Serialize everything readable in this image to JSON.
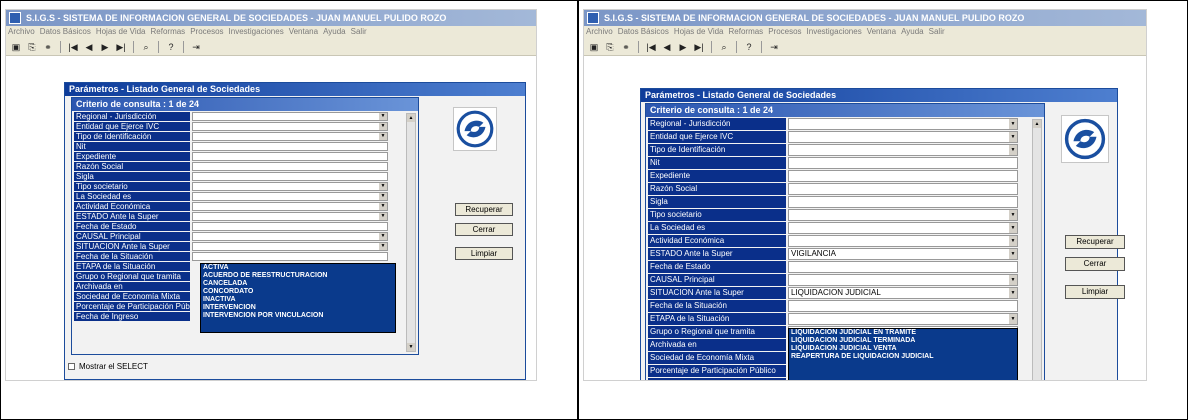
{
  "app": {
    "title": "S.I.G.S   - SISTEMA DE INFORMACION GENERAL DE SOCIEDADES - JUAN MANUEL PULIDO ROZO",
    "menu": [
      "Archivo",
      "Datos Básicos",
      "Hojas de Vida",
      "Reformas",
      "Procesos",
      "Investigaciones",
      "Ventana",
      "Ayuda",
      "Salir"
    ],
    "toolbar": [
      {
        "icon": "save-icon",
        "glyph": "▣"
      },
      {
        "icon": "copy-icon",
        "glyph": "⎘"
      },
      {
        "icon": "link-icon",
        "glyph": "⚭"
      },
      {
        "icon": "first-record-icon",
        "glyph": "|◀"
      },
      {
        "icon": "previous-record-icon",
        "glyph": "◀"
      },
      {
        "icon": "next-record-icon",
        "glyph": "▶"
      },
      {
        "icon": "last-record-icon",
        "glyph": "▶|"
      },
      {
        "icon": "query-icon",
        "glyph": "⌕"
      },
      {
        "icon": "help-icon",
        "glyph": "?"
      },
      {
        "icon": "exit-icon",
        "glyph": "⇥"
      }
    ]
  },
  "window": {
    "title": "Parámetros -  Listado General de Sociedades",
    "criteria": "Criterio de consulta : 1  de  24"
  },
  "fields": [
    {
      "label": "Regional - Jurisdicción",
      "type": "combo"
    },
    {
      "label": "Entidad que Ejerce IVC",
      "type": "combo"
    },
    {
      "label": "Tipo de Identificación",
      "type": "combo"
    },
    {
      "label": "Nit",
      "type": "text"
    },
    {
      "label": "Expediente",
      "type": "text"
    },
    {
      "label": "Razón Social",
      "type": "text"
    },
    {
      "label": "Sigla",
      "type": "text"
    },
    {
      "label": "Tipo societario",
      "type": "combo"
    },
    {
      "label": "La Sociedad es",
      "type": "combo"
    },
    {
      "label": "Actividad Económica",
      "type": "combo"
    },
    {
      "label": "ESTADO Ante la Super",
      "type": "combo"
    },
    {
      "label": "Fecha de Estado",
      "type": "text"
    },
    {
      "label": "CAUSAL Principal",
      "type": "combo"
    },
    {
      "label": "SITUACION Ante la Super",
      "type": "combo"
    },
    {
      "label": "Fecha de la Situación",
      "type": "text"
    },
    {
      "label": "ETAPA de la Situación",
      "type": "combo"
    },
    {
      "label": "Grupo o Regional que tramita",
      "type": "text"
    },
    {
      "label": "Archivada en",
      "type": "text"
    },
    {
      "label": "Sociedad de Economía Mixta",
      "type": "text"
    },
    {
      "label": "Porcentaje de Participación Público",
      "type": "text"
    },
    {
      "label": "Fecha de Ingreso",
      "type": "text"
    }
  ],
  "left": {
    "visible_fields": 15,
    "open_list": [
      "ACTIVA",
      "ACUERDO DE REESTRUCTURACION",
      "CANCELADA",
      "CONCORDATO",
      "INACTIVA",
      "INTERVENCION",
      "INTERVENCION POR VINCULACION"
    ]
  },
  "right": {
    "values": {
      "ESTADO Ante la Super": "VIGILANCIA",
      "SITUACION Ante la Super": "LIQUIDACION JUDICIAL"
    },
    "open_list": [
      "LIQUIDACION JUDICIAL EN TRAMITE",
      "LIQUIDACION JUDICIAL TERMINADA",
      "LIQUIDACION JUDICIAL VENTA",
      "REAPERTURA DE LIQUIDACION JUDICIAL"
    ]
  },
  "buttons": {
    "recuperar": "Recuperar",
    "cerrar": "Cerrar",
    "limpiar": "Limpiar"
  },
  "checkbox": {
    "label": "Mostrar el SELECT"
  },
  "colors": {
    "label_bg": "#0a2f8a",
    "title_bg": "#0e3c9a",
    "list_bg": "#0a3a8c"
  }
}
